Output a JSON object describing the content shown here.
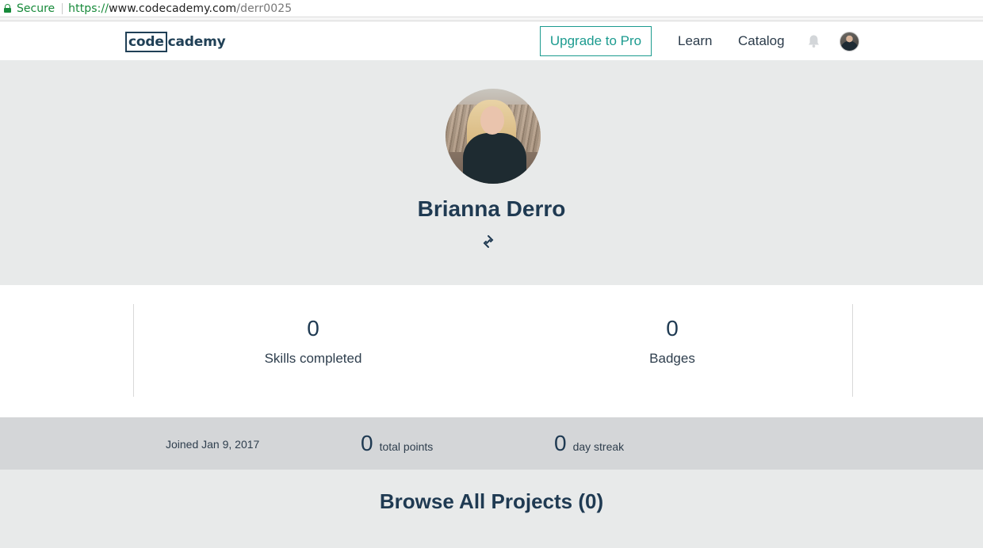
{
  "browser": {
    "secure_label": "Secure",
    "url_scheme": "https://",
    "url_host": "www.codecademy.com",
    "url_path": "/derr0025"
  },
  "header": {
    "logo_boxed": "code",
    "logo_rest": "cademy",
    "upgrade_label": "Upgrade to Pro",
    "nav": {
      "learn": "Learn",
      "catalog": "Catalog"
    },
    "icons": {
      "notifications": "bell-icon",
      "avatar": "user-avatar"
    }
  },
  "profile": {
    "name": "Brianna Derro",
    "link_icon": "link-icon"
  },
  "stats": {
    "skills_completed": {
      "value": "0",
      "label": "Skills completed"
    },
    "badges": {
      "value": "0",
      "label": "Badges"
    }
  },
  "summary": {
    "joined": "Joined Jan 9, 2017",
    "total_points": {
      "value": "0",
      "label": "total points"
    },
    "day_streak": {
      "value": "0",
      "label": "day streak"
    }
  },
  "projects": {
    "title": "Browse All Projects (0)"
  },
  "colors": {
    "brand_navy": "#204056",
    "accent_teal": "#1c9b8f",
    "secure_green": "#178a3a",
    "hero_bg": "#e8eaea",
    "summary_bg": "#d4d6d8"
  }
}
